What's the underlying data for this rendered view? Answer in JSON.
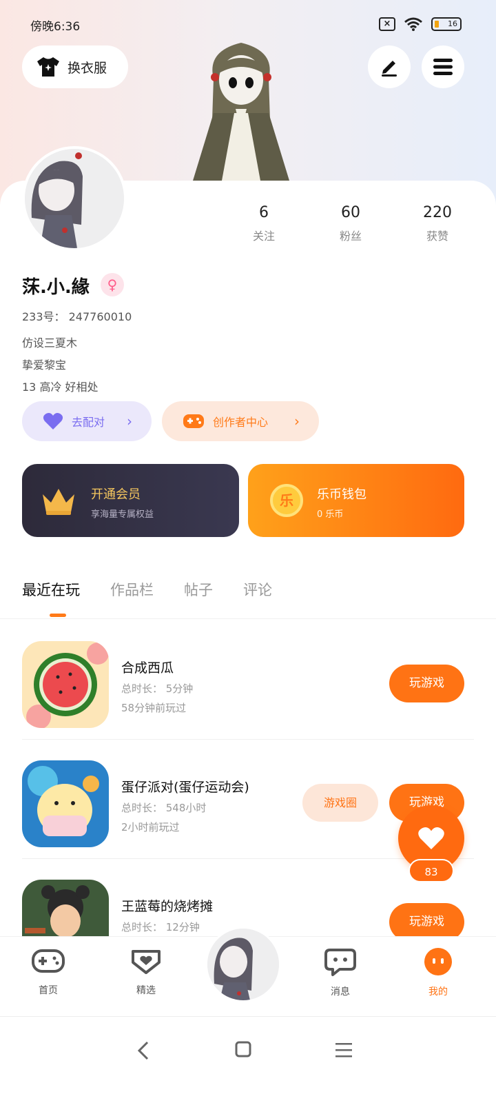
{
  "status_bar": {
    "time": "傍晚6:36",
    "battery": "16"
  },
  "header": {
    "outfit_label": "换衣服"
  },
  "stats": [
    {
      "value": "6",
      "label": "关注"
    },
    {
      "value": "60",
      "label": "粉丝"
    },
    {
      "value": "220",
      "label": "获赞"
    }
  ],
  "profile": {
    "username": "莯.小.緣",
    "gender_symbol": "♀",
    "id_line": "233号： 247760010",
    "bio_lines": [
      "仿设三夏木",
      "挚爱黎宝",
      "13 高冷 好相处"
    ]
  },
  "actions": {
    "match_label": "去配对",
    "creator_label": "创作者中心"
  },
  "cards": {
    "vip": {
      "title": "开通会员",
      "subtitle": "享海量专属权益"
    },
    "wallet": {
      "title": "乐币钱包",
      "subtitle": "0 乐币",
      "coin_char": "乐"
    }
  },
  "tabs": [
    "最近在玩",
    "作品栏",
    "帖子",
    "评论"
  ],
  "games": [
    {
      "name": "合成西瓜",
      "duration": "总时长： 5分钟",
      "last_played": "58分钟前玩过",
      "play_label": "玩游戏",
      "circle_label": ""
    },
    {
      "name": "蛋仔派对(蛋仔运动会)",
      "duration": "总时长： 548小时",
      "last_played": "2小时前玩过",
      "play_label": "玩游戏",
      "circle_label": "游戏圈"
    },
    {
      "name": "王蓝莓的烧烤摊",
      "duration": "总时长： 12分钟",
      "last_played": "",
      "play_label": "玩游戏",
      "circle_label": ""
    }
  ],
  "like": {
    "count": "83"
  },
  "nav": {
    "items": [
      "首页",
      "精选",
      "消息",
      "我的"
    ]
  },
  "colors": {
    "accent": "#ff7314",
    "vip_gold": "#f6c75e",
    "match_purple": "#7a6df0"
  },
  "icons": [
    "shirt-icon",
    "pencil-icon",
    "menu-icon",
    "crown-icon",
    "coin-icon",
    "heart-icon",
    "gamepad-icon",
    "chat-icon"
  ]
}
